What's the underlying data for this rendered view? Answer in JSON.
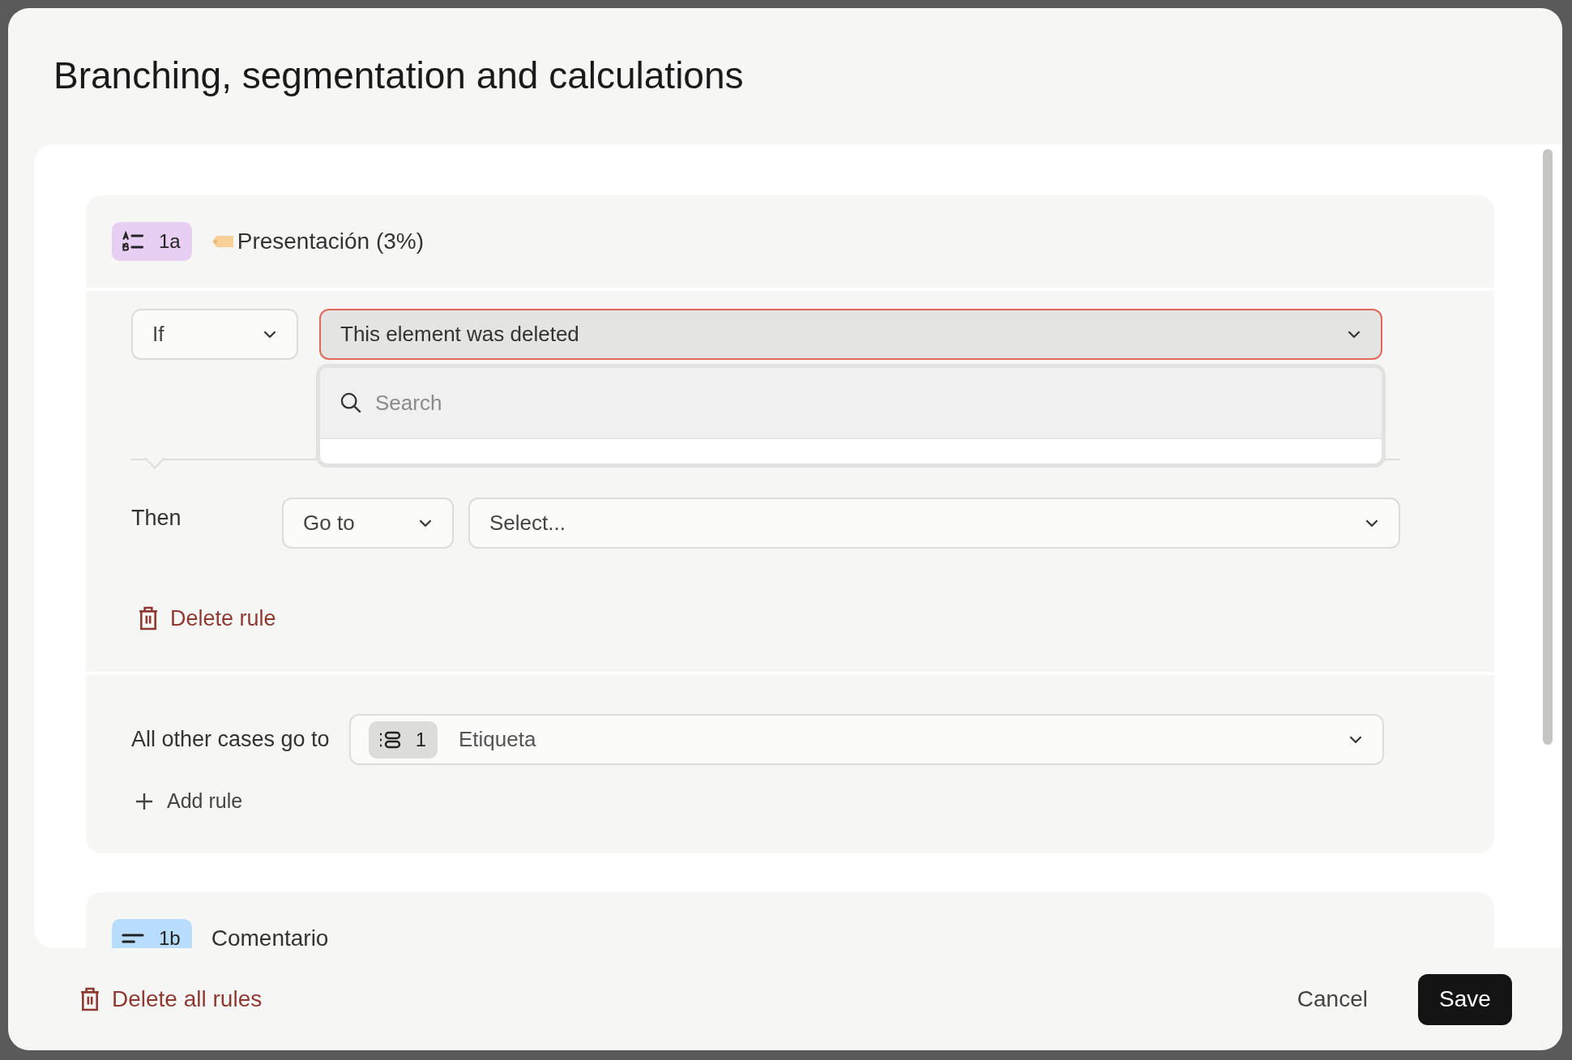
{
  "dialog": {
    "title": "Branching, segmentation and calculations"
  },
  "rules": [
    {
      "badge": {
        "kind": "choice",
        "label": "1a"
      },
      "tag": true,
      "question": "Presentación (3%)",
      "condition": {
        "operator": "If",
        "field": "This element was deleted",
        "error": true,
        "dropdown": {
          "placeholder": "Search"
        }
      },
      "action": {
        "label": "Then",
        "verb": "Go to",
        "target_placeholder": "Select..."
      },
      "delete": "Delete rule",
      "fallback": {
        "label": "All other cases go to",
        "badge": "1",
        "target": "Etiqueta"
      },
      "add": "Add rule"
    },
    {
      "badge": {
        "kind": "text",
        "label": "1b"
      },
      "tag": false,
      "question": "Comentario"
    }
  ],
  "footer": {
    "delete_all": "Delete all rules",
    "cancel": "Cancel",
    "save": "Save"
  }
}
